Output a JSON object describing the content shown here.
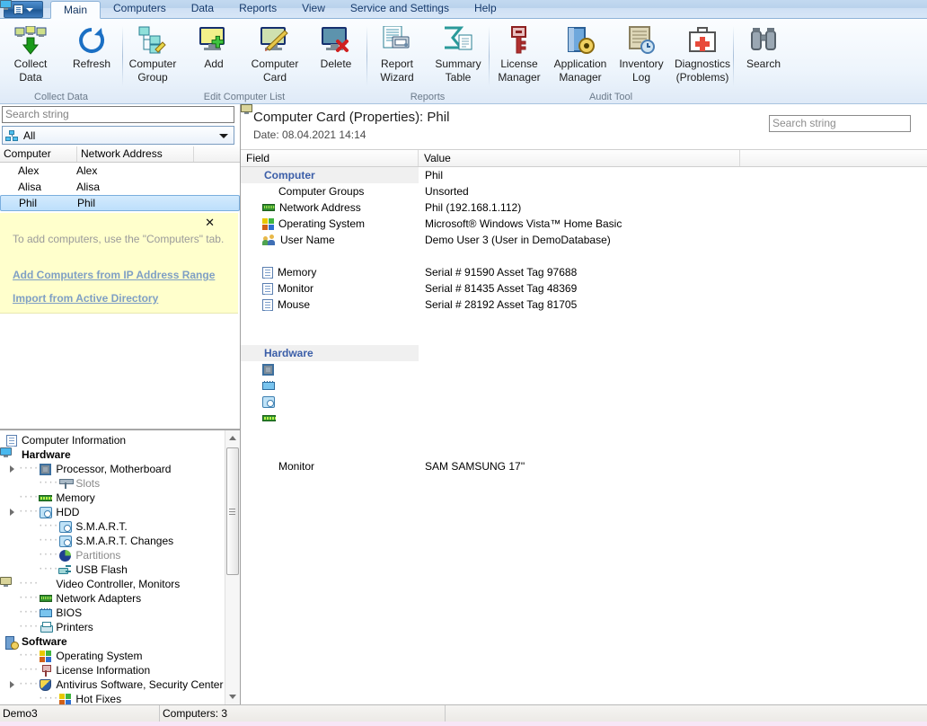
{
  "window": {
    "app_menu_icon": "app-menu-icon"
  },
  "tabs": [
    {
      "label": "Main",
      "active": true
    },
    {
      "label": "Computers",
      "active": false
    },
    {
      "label": "Data",
      "active": false
    },
    {
      "label": "Reports",
      "active": false
    },
    {
      "label": "View",
      "active": false
    },
    {
      "label": "Service and Settings",
      "active": false
    },
    {
      "label": "Help",
      "active": false
    }
  ],
  "ribbon": {
    "groups": [
      {
        "label": "Collect Data",
        "buttons": [
          {
            "label": "Collect\nData",
            "line1": "Collect",
            "line2": "Data",
            "icon": "collect-data-icon"
          },
          {
            "label": "Refresh",
            "line1": "Refresh",
            "line2": "",
            "icon": "refresh-icon"
          }
        ]
      },
      {
        "label": "Edit Computer List",
        "buttons": [
          {
            "line1": "Computer",
            "line2": "Group",
            "icon": "computer-group-icon"
          },
          {
            "line1": "Add",
            "line2": "",
            "icon": "add-computer-icon"
          },
          {
            "line1": "Computer",
            "line2": "Card",
            "icon": "computer-card-icon"
          },
          {
            "line1": "Delete",
            "line2": "",
            "icon": "delete-computer-icon"
          }
        ]
      },
      {
        "label": "Reports",
        "buttons": [
          {
            "line1": "Report",
            "line2": "Wizard",
            "icon": "report-wizard-icon"
          },
          {
            "line1": "Summary",
            "line2": "Table",
            "icon": "summary-table-icon"
          }
        ]
      },
      {
        "label": "Audit Tool",
        "buttons": [
          {
            "line1": "License",
            "line2": "Manager",
            "icon": "license-manager-icon"
          },
          {
            "line1": "Application",
            "line2": "Manager",
            "icon": "application-manager-icon"
          },
          {
            "line1": "Inventory",
            "line2": "Log",
            "icon": "inventory-log-icon"
          },
          {
            "line1": "Diagnostics",
            "line2": "(Problems)",
            "icon": "diagnostics-icon"
          }
        ]
      },
      {
        "label": "",
        "buttons": [
          {
            "line1": "Search",
            "line2": "",
            "icon": "search-binoculars-icon"
          }
        ]
      }
    ]
  },
  "left_panel": {
    "search_placeholder": "Search string",
    "group_filter": {
      "value": "All",
      "icon": "network-group-icon"
    },
    "columns": [
      "Computer",
      "Network Address"
    ],
    "rows": [
      {
        "computer": "Alex",
        "address": "Alex",
        "selected": false,
        "icon": "computer-icon"
      },
      {
        "computer": "Alisa",
        "address": "Alisa",
        "selected": false,
        "icon": "computer-icon"
      },
      {
        "computer": "Phil",
        "address": "Phil",
        "selected": true,
        "icon": "computer-icon"
      }
    ],
    "info_box": {
      "close_icon": "close-icon",
      "message": "To add computers, use the \"Computers\" tab.",
      "links": [
        "Add Computers from IP Address Range",
        "Import from Active Directory"
      ]
    }
  },
  "tree": [
    {
      "label": "Computer Information",
      "depth": 0,
      "icon": "document-icon",
      "bold": false,
      "dim": false,
      "twisty": false
    },
    {
      "label": "Hardware",
      "depth": 0,
      "icon": "monitor-blue-icon",
      "bold": true,
      "dim": false,
      "twisty": false
    },
    {
      "label": "Processor, Motherboard",
      "depth": 1,
      "icon": "cpu-icon",
      "bold": false,
      "dim": false,
      "twisty": true
    },
    {
      "label": "Slots",
      "depth": 2,
      "icon": "slots-icon",
      "bold": false,
      "dim": true,
      "twisty": false
    },
    {
      "label": "Memory",
      "depth": 1,
      "icon": "ram-icon",
      "bold": false,
      "dim": false,
      "twisty": false
    },
    {
      "label": "HDD",
      "depth": 1,
      "icon": "hdd-icon",
      "bold": false,
      "dim": false,
      "twisty": true
    },
    {
      "label": "S.M.A.R.T.",
      "depth": 2,
      "icon": "hdd-icon",
      "bold": false,
      "dim": false,
      "twisty": false
    },
    {
      "label": "S.M.A.R.T. Changes",
      "depth": 2,
      "icon": "hdd-icon",
      "bold": false,
      "dim": false,
      "twisty": false
    },
    {
      "label": "Partitions",
      "depth": 2,
      "icon": "pie-chart-icon",
      "bold": false,
      "dim": true,
      "twisty": false
    },
    {
      "label": "USB Flash",
      "depth": 2,
      "icon": "usb-icon",
      "bold": false,
      "dim": false,
      "twisty": false
    },
    {
      "label": "Video Controller, Monitors",
      "depth": 1,
      "icon": "monitor-khaki-icon",
      "bold": false,
      "dim": false,
      "twisty": false
    },
    {
      "label": "Network Adapters",
      "depth": 1,
      "icon": "network-card-icon",
      "bold": false,
      "dim": false,
      "twisty": false
    },
    {
      "label": "BIOS",
      "depth": 1,
      "icon": "bios-icon",
      "bold": false,
      "dim": false,
      "twisty": false
    },
    {
      "label": "Printers",
      "depth": 1,
      "icon": "printer-icon",
      "bold": false,
      "dim": false,
      "twisty": false
    },
    {
      "label": "Software",
      "depth": 0,
      "icon": "software-icon",
      "bold": true,
      "dim": false,
      "twisty": false
    },
    {
      "label": "Operating System",
      "depth": 1,
      "icon": "windows-logo-icon",
      "bold": false,
      "dim": false,
      "twisty": false
    },
    {
      "label": "License Information",
      "depth": 1,
      "icon": "key-icon",
      "bold": false,
      "dim": false,
      "twisty": false
    },
    {
      "label": "Antivirus Software, Security Center",
      "depth": 1,
      "icon": "shield-icon",
      "bold": false,
      "dim": false,
      "twisty": true
    },
    {
      "label": "Hot Fixes",
      "depth": 2,
      "icon": "windows-logo-icon",
      "bold": false,
      "dim": false,
      "twisty": false
    }
  ],
  "card": {
    "title": "Computer Card (Properties): Phil",
    "date": "Date: 08.04.2021 14:14",
    "search_placeholder": "Search string",
    "columns": [
      "Field",
      "Value"
    ],
    "rows": [
      {
        "field": "Computer",
        "value": "Phil",
        "group": true,
        "indent": false,
        "icon": "monitor-blue-icon"
      },
      {
        "field": "Computer Groups",
        "value": "Unsorted",
        "group": false,
        "indent": true,
        "icon": "monitor-blue-icon"
      },
      {
        "field": "Network Address",
        "value": "Phil (192.168.1.112)",
        "group": false,
        "indent": true,
        "icon": "network-card-icon"
      },
      {
        "field": "Operating System",
        "value": "Microsoft® Windows Vista™ Home Basic",
        "group": false,
        "indent": true,
        "icon": "windows-logo-icon"
      },
      {
        "field": "User Name",
        "value": "Demo User 3 (User in DemoDatabase)",
        "group": false,
        "indent": true,
        "icon": "users-icon"
      },
      {
        "field": "",
        "value": "",
        "group": false,
        "indent": true,
        "icon": "none"
      },
      {
        "field": "Memory",
        "value": "Serial # 91590 Asset Tag 97688",
        "group": false,
        "indent": true,
        "icon": "document-icon"
      },
      {
        "field": "Monitor",
        "value": "Serial # 81435 Asset Tag 48369",
        "group": false,
        "indent": true,
        "icon": "document-icon"
      },
      {
        "field": "Mouse",
        "value": "Serial # 28192 Asset Tag 81705",
        "group": false,
        "indent": true,
        "icon": "document-icon"
      },
      {
        "field": "",
        "value": "",
        "group": false,
        "indent": true,
        "icon": "none"
      },
      {
        "field": "",
        "value": "",
        "group": false,
        "indent": true,
        "icon": "none"
      },
      {
        "field": "Hardware",
        "value": "",
        "group": true,
        "indent": false,
        "icon": "monitor-cyan-icon"
      },
      {
        "field": "",
        "value": "",
        "group": false,
        "indent": true,
        "icon": "cpu-icon"
      },
      {
        "field": "",
        "value": "",
        "group": false,
        "indent": true,
        "icon": "bios-icon"
      },
      {
        "field": "",
        "value": "",
        "group": false,
        "indent": true,
        "icon": "hdd-icon"
      },
      {
        "field": "",
        "value": "",
        "group": false,
        "indent": true,
        "icon": "ram-icon"
      },
      {
        "field": "",
        "value": "",
        "group": false,
        "indent": true,
        "icon": "monitor-khaki-icon"
      },
      {
        "field": "",
        "value": "",
        "group": false,
        "indent": true,
        "icon": "monitor-khaki-icon"
      },
      {
        "field": "Monitor",
        "value": "SAM SAMSUNG 17''",
        "group": false,
        "indent": true,
        "icon": "monitor-khaki-icon"
      }
    ]
  },
  "statusbar": {
    "database": "Demo3",
    "computers": "Computers: 3"
  },
  "colors": {
    "accent": "#3b5ea8",
    "ribbon_bg": "#eef5fc",
    "selection": "#bddffb",
    "info_bg": "#ffffcc",
    "link": "#7f9fc4"
  }
}
